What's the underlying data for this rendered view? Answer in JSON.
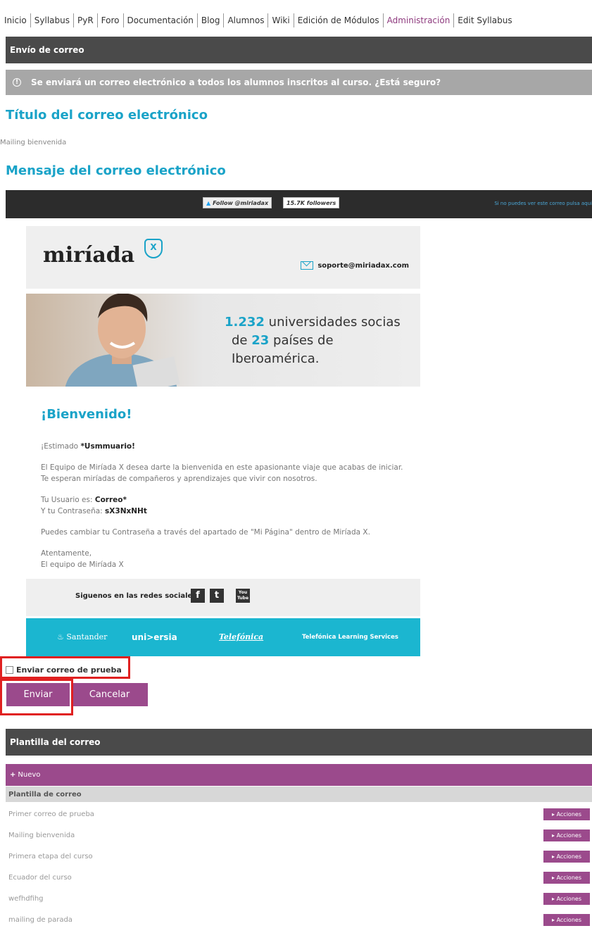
{
  "nav": [
    "Inicio",
    "Syllabus",
    "PyR",
    "Foro",
    "Documentación",
    "Blog",
    "Alumnos",
    "Wiki",
    "Edición de Módulos",
    "Administración",
    "Edit Syllabus"
  ],
  "nav_active_index": 9,
  "section_header": "Envío de correo",
  "warning": "Se enviará un correo electrónico a todos los alumnos inscritos al curso. ¿Está seguro?",
  "title_heading": "Título del correo electrónico",
  "subject_value": "Mailing bienvenida",
  "message_heading": "Mensaje del correo electrónico",
  "email": {
    "follow_label": "Follow @miriadax",
    "follow_count": "15.7K followers",
    "top_link_text": "Si no puedes ver este correo pulsa aqui",
    "logo_text": "miríada",
    "logo_mark": "X",
    "support_email": "soporte@miriadax.com",
    "banner_n1": "1.232",
    "banner_t1": " universidades socias",
    "banner_t2a": "de ",
    "banner_n2": "23",
    "banner_t2b": " países de Iberoamérica.",
    "welcome": "¡Bienvenido!",
    "greeting_prefix": "¡Estimado ",
    "greeting_name": "*Usmmuario!",
    "intro_line1": "El Equipo de Miríada X desea darte la bienvenida en este apasionante viaje que acabas de iniciar.",
    "intro_line2": "Te esperan miríadas de compañeros y aprendizajes que vivir con nosotros.",
    "user_prefix": "Tu Usuario es: ",
    "user_value": "Correo*",
    "pass_prefix": "Y tu Contraseña: ",
    "pass_value": "sX3NxNHt",
    "change_pass": "Puedes cambiar tu Contraseña a través del apartado de \"Mi Página\" dentro de Miríada X.",
    "signoff1": "Atentamente,",
    "signoff2": "El equipo de Miríada X",
    "social_label": "Siguenos en las redes sociales",
    "social_icons": [
      "f",
      "t",
      "You Tube"
    ],
    "partners": [
      "Santander",
      "uni>ersia",
      "Telefónica",
      "Telefónica Learning Services"
    ]
  },
  "test_label": "Enviar correo de prueba",
  "send_label": "Enviar",
  "cancel_label": "Cancelar",
  "templates_header": "Plantilla del correo",
  "new_label": "Nuevo",
  "table_header": "Plantilla de correo",
  "templates": [
    {
      "name": "Primer correo de prueba",
      "action": "Acciones"
    },
    {
      "name": "Mailing bienvenida",
      "action": "Acciones"
    },
    {
      "name": "Primera etapa del curso",
      "action": "Acciones"
    },
    {
      "name": "Ecuador del curso",
      "action": "Acciones"
    },
    {
      "name": "wefhdfihg",
      "action": "Acciones"
    },
    {
      "name": "mailing de parada",
      "action": "Acciones"
    }
  ],
  "colors": {
    "accent": "#9b4a8c",
    "teal": "#1aa3c8",
    "dark": "#4a4a4a",
    "highlight": "#e02020"
  }
}
